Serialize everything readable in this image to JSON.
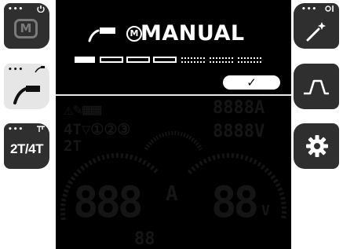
{
  "left_buttons": [
    {
      "id": "mode",
      "dots": "•••",
      "label": "M"
    },
    {
      "id": "process",
      "dots": "•••"
    },
    {
      "id": "trigger",
      "dots": "•••",
      "label": "2T/4T"
    }
  ],
  "right_buttons": [
    {
      "id": "wizard",
      "dots": "•••"
    },
    {
      "id": "waveform"
    },
    {
      "id": "settings"
    }
  ],
  "screen": {
    "mode_letter": "M",
    "mode_title": "MANUAL",
    "confirm_symbol": "✓",
    "step_indicator": {
      "filled": 1,
      "outline": 3,
      "dotted": 3
    }
  },
  "ghost_lcd": {
    "top_row_left": "⚠✎▦▦",
    "top_row_right": "8888A",
    "mid_row_left": "4T▽①②③",
    "mid_row_right": "8888V",
    "mode_row": "2T",
    "big_left": "888",
    "big_right": "88",
    "unit_a": "A",
    "unit_v": "V",
    "bottom": "88"
  },
  "colors": {
    "button_bg": "#2f2f2f",
    "button_active_bg": "#e6e6e6",
    "screen_bg": "#000000",
    "ghost": "#161616",
    "text_on_screen": "#ffffff"
  },
  "icons": {
    "mode": "m-badge-icon",
    "process": "mig-torch-icon",
    "trigger": "trigger-icon",
    "wizard": "magic-wand-icon",
    "waveform": "pulse-waveform-icon",
    "settings": "gear-icon"
  }
}
